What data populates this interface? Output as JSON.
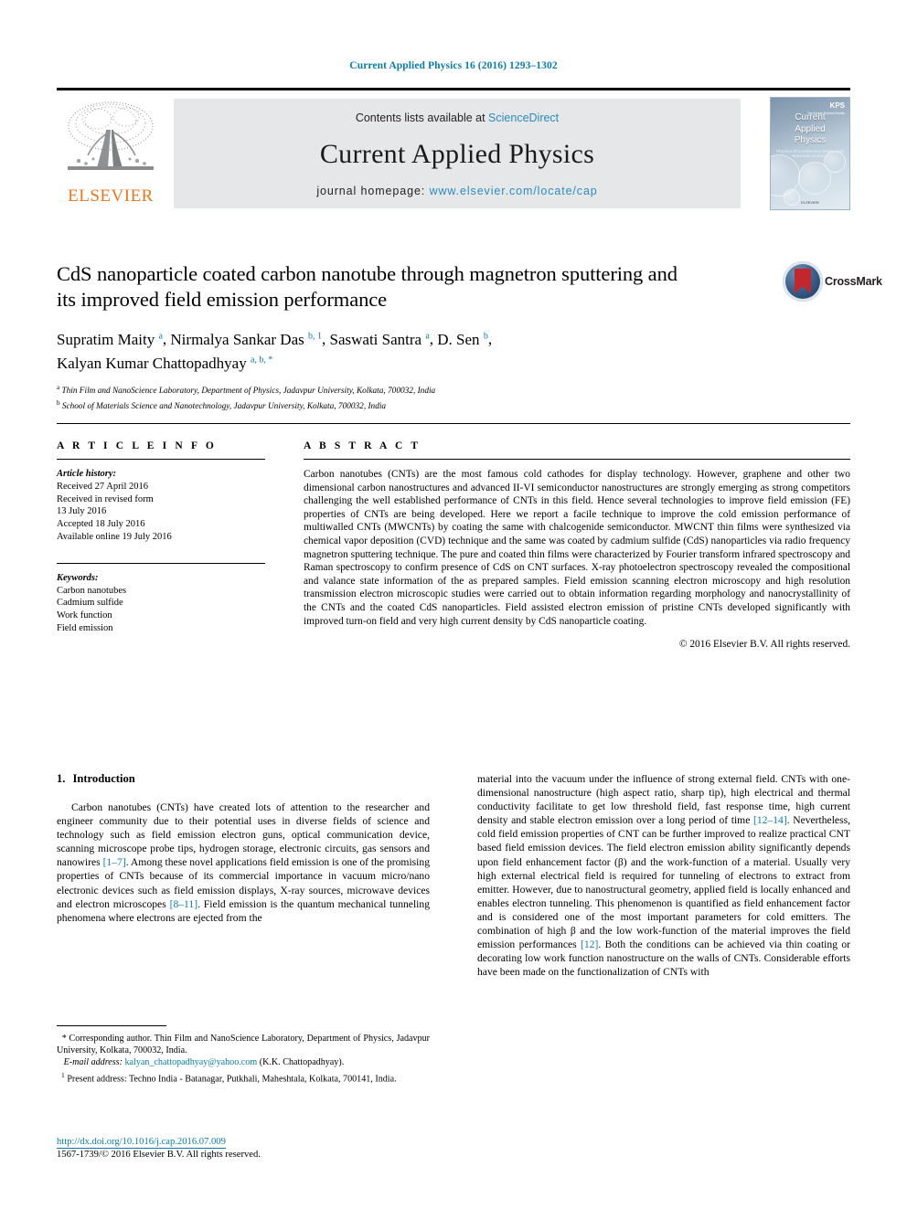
{
  "running_head": "Current Applied Physics 16 (2016) 1293–1302",
  "masthead": {
    "publisher_name": "ELSEVIER",
    "publisher_logo_name": "elsevier-tree-logo",
    "contents_prefix": "Contents lists available at ",
    "contents_link": "ScienceDirect",
    "journal_name": "Current Applied Physics",
    "homepage_prefix": "journal homepage: ",
    "homepage_url": "www.elsevier.com/locate/cap",
    "cover": {
      "title_line1": "Current",
      "title_line2": "Applied",
      "title_line3": "Physics",
      "subtitle": "Physics of Condensed Matter and Materials Science",
      "society": "KPS",
      "society_sub": "The Korean Physical Society",
      "footer": "ELSEVIER"
    }
  },
  "crossmark": {
    "label": "CrossMark",
    "badge_name": "crossmark-badge-icon"
  },
  "article": {
    "title_line1": "CdS nanoparticle coated carbon nanotube through magnetron",
    "title_line2": "sputtering and its improved field emission performance",
    "authors": [
      {
        "name": "Supratim Maity",
        "sup": "a",
        "sep": ", "
      },
      {
        "name": "Nirmalya Sankar Das",
        "sup": "b, 1",
        "sep": ", "
      },
      {
        "name": "Saswati Santra",
        "sup": "a",
        "sep": ", "
      },
      {
        "name": "D. Sen",
        "sup": "b",
        "sep": ","
      },
      {
        "name": "Kalyan Kumar Chattopadhyay",
        "sup": "a, b, *",
        "sep": ""
      }
    ],
    "affiliations": [
      {
        "mark": "a",
        "text": "Thin Film and NanoScience Laboratory, Department of Physics, Jadavpur University, Kolkata, 700032, India"
      },
      {
        "mark": "b",
        "text": "School of Materials Science and Nanotechnology, Jadavpur University, Kolkata, 700032, India"
      }
    ]
  },
  "article_info": {
    "heading": "A R T I C L E  I N F O",
    "history_label": "Article history:",
    "history": [
      "Received 27 April 2016",
      "Received in revised form",
      "13 July 2016",
      "Accepted 18 July 2016",
      "Available online 19 July 2016"
    ],
    "keywords_label": "Keywords:",
    "keywords": [
      "Carbon nanotubes",
      "Cadmium sulfide",
      "Work function",
      "Field emission"
    ]
  },
  "abstract": {
    "heading": "A B S T R A C T",
    "text": "Carbon nanotubes (CNTs) are the most famous cold cathodes for display technology. However, graphene and other two dimensional carbon nanostructures and advanced II-VI semiconductor nanostructures are strongly emerging as strong competitors challenging the well established performance of CNTs in this field. Hence several technologies to improve field emission (FE) properties of CNTs are being developed. Here we report a facile technique to improve the cold emission performance of multiwalled CNTs (MWCNTs) by coating the same with chalcogenide semiconductor. MWCNT thin films were synthesized via chemical vapor deposition (CVD) technique and the same was coated by cadmium sulfide (CdS) nanoparticles via radio frequency magnetron sputtering technique. The pure and coated thin films were characterized by Fourier transform infrared spectroscopy and Raman spectroscopy to confirm presence of CdS on CNT surfaces. X-ray photoelectron spectroscopy revealed the compositional and valance state information of the as prepared samples. Field emission scanning electron microscopy and high resolution transmission electron microscopic studies were carried out to obtain information regarding morphology and nanocrystallinity of the CNTs and the coated CdS nanoparticles. Field assisted electron emission of pristine CNTs developed significantly with improved turn-on field and very high current density by CdS nanoparticle coating.",
    "copyright": "© 2016 Elsevier B.V. All rights reserved."
  },
  "introduction": {
    "section_number": "1.",
    "section_title": "Introduction",
    "left_para_parts": {
      "p1": "Carbon nanotubes (CNTs) have created lots of attention to the researcher and engineer community due to their potential uses in diverse fields of science and technology such as field emission electron guns, optical communication device, scanning microscope probe tips, hydrogen storage, electronic circuits, gas sensors and nanowires ",
      "ref1": "[1–7]",
      "p2": ". Among these novel applications field emission is one of the promising properties of CNTs because of its commercial importance in vacuum micro/nano electronic devices such as field emission displays, X-ray sources, microwave devices and electron microscopes ",
      "ref2": "[8–11]",
      "p3": ". Field emission is the quantum mechanical tunneling phenomena where electrons are ejected from the"
    },
    "right_para_parts": {
      "p1": "material into the vacuum under the influence of strong external field. CNTs with one-dimensional nanostructure (high aspect ratio, sharp tip), high electrical and thermal conductivity facilitate to get low threshold field, fast response time, high current density and stable electron emission over a long period of time ",
      "ref1": "[12–14]",
      "p2": ". Nevertheless, cold field emission properties of CNT can be further improved to realize practical CNT based field emission devices. The field electron emission ability significantly depends upon field enhancement factor (β) and the work-function of a material. Usually very high external electrical field is required for tunneling of electrons to extract from emitter. However, due to nanostructural geometry, applied field is locally enhanced and enables electron tunneling. This phenomenon is quantified as field enhancement factor and is considered one of the most important parameters for cold emitters. The combination of high β and the low work-function of the material improves the field emission performances ",
      "ref2": "[12]",
      "p3": ". Both the conditions can be achieved via thin coating or decorating low work function nanostructure on the walls of CNTs. Considerable efforts have been made on the functionalization of CNTs with"
    }
  },
  "footnotes": {
    "corresponding_mark": "*",
    "corresponding_text": " Corresponding author. Thin Film and NanoScience Laboratory, Department of Physics, Jadavpur University, Kolkata, 700032, India.",
    "email_label": "E-mail address:",
    "email": "kalyan_chattopadhyay@yahoo.com",
    "email_owner": "(K.K. Chattopadhyay).",
    "present_mark": "1",
    "present_text": " Present address: Techno India - Batanagar, Putkhali, Maheshtala, Kolkata, 700141, India."
  },
  "footer": {
    "doi": "http://dx.doi.org/10.1016/j.cap.2016.07.009",
    "issn_line": "1567-1739/© 2016 Elsevier B.V. All rights reserved."
  },
  "colors": {
    "link": "#0b7ba8",
    "elsevier_orange": "#e87722",
    "masthead_gray": "#e6e7e8",
    "crossmark_red": "#c1272d"
  }
}
